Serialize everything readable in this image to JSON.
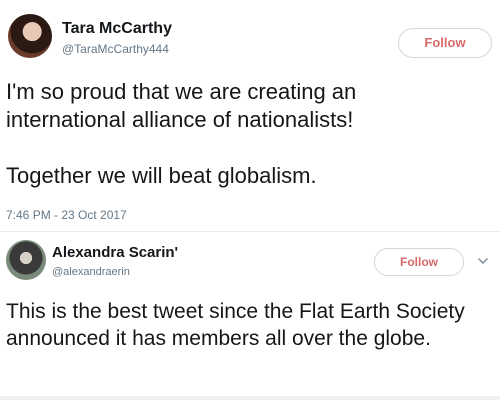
{
  "main_tweet": {
    "display_name": "Tara McCarthy",
    "handle": "@TaraMcCarthy444",
    "follow_label": "Follow",
    "text_line_1": "I'm so proud that we are creating an international alliance of nationalists!",
    "text_line_2": "Together we will beat globalism.",
    "timestamp": "7:46 PM - 23 Oct 2017"
  },
  "reply_tweet": {
    "display_name": "Alexandra Scarin'",
    "handle": "@alexandraerin",
    "follow_label": "Follow",
    "text": "This is the best tweet since the Flat Earth Society announced it has members all over the globe."
  },
  "colors": {
    "follow_text": "#d86a6a",
    "handle_text": "#657786",
    "body_text": "#14171a"
  },
  "icons": {
    "reply_menu": "chevron-down-icon"
  }
}
